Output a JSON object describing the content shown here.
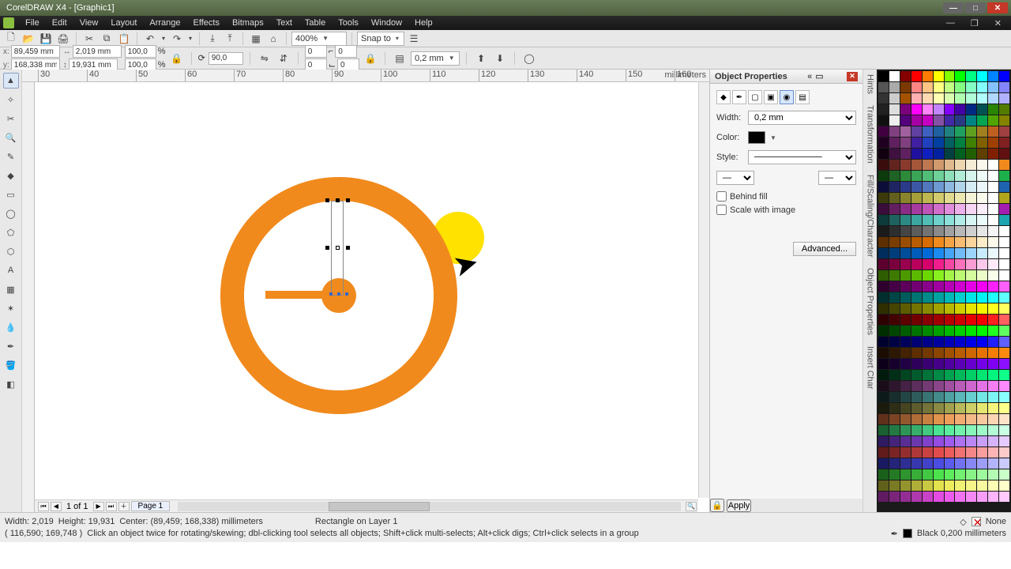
{
  "titlebar": {
    "title": "CorelDRAW X4 - [Graphic1]"
  },
  "menu": {
    "items": [
      "File",
      "Edit",
      "View",
      "Layout",
      "Arrange",
      "Effects",
      "Bitmaps",
      "Text",
      "Table",
      "Tools",
      "Window",
      "Help"
    ]
  },
  "toolbar1": {
    "zoom": "400%",
    "snap": "Snap to"
  },
  "propbar": {
    "x": "89,459 mm",
    "y": "168,338 mm",
    "w": "2,019 mm",
    "h": "19,931 mm",
    "sx": "100,0",
    "sy": "100,0",
    "rot": "90,0",
    "outline": "0,2 mm"
  },
  "ruler_unit": "millimeters",
  "hruler": {
    "start": 30,
    "end": 160,
    "step": 10
  },
  "vruler": {
    "values": [
      "",
      "",
      "",
      "",
      "",
      ""
    ]
  },
  "pages": {
    "label": "1 of 1",
    "tab": "Page 1"
  },
  "props": {
    "title": "Object Properties",
    "width_label": "Width:",
    "width_value": "0,2 mm",
    "color_label": "Color:",
    "style_label": "Style:",
    "behind": "Behind fill",
    "scale": "Scale with image",
    "advanced": "Advanced...",
    "apply": "Apply"
  },
  "sidetabs": [
    "Hints",
    "Transformation",
    "Fill/Scaling/Character",
    "Object Properties",
    "Insert Char"
  ],
  "status": {
    "line1_a": "Width: 2,019",
    "line1_b": "Height: 19,931",
    "line1_c": "Center: (89,459; 168,338)  millimeters",
    "line1_d": "Rectangle on Layer 1",
    "line2_a": "( 116,590; 169,748 )",
    "line2_b": "Click an object twice for rotating/skewing; dbl-clicking tool selects all objects; Shift+click multi-selects; Alt+click digs; Ctrl+click selects in a group",
    "fill_none": "None",
    "outline_info": "Black  0,200 millimeters"
  },
  "palette_colors": [
    "#000000",
    "#ffffff",
    "#840000",
    "#ff0000",
    "#ff7b00",
    "#ffff00",
    "#84ff00",
    "#00ff00",
    "#00ff84",
    "#00ffff",
    "#0084ff",
    "#0000ff",
    "#555555",
    "#aaaaaa",
    "#7b3900",
    "#ff8484",
    "#ffc384",
    "#ffff84",
    "#c3ff84",
    "#84ff84",
    "#84ffc3",
    "#84ffff",
    "#84c3ff",
    "#8484ff",
    "#333333",
    "#cccccc",
    "#a55200",
    "#ffb1b1",
    "#ffd9b1",
    "#ffffb1",
    "#d9ffb1",
    "#b1ffb1",
    "#b1ffd9",
    "#b1ffff",
    "#b1d9ff",
    "#b1b1ff",
    "#222222",
    "#dddddd",
    "#7b007b",
    "#ff00ff",
    "#ff84ff",
    "#c384ff",
    "#8400ff",
    "#4200a5",
    "#002984",
    "#005252",
    "#298400",
    "#527b00",
    "#111111",
    "#eeeeee",
    "#52007b",
    "#a500a5",
    "#c300c3",
    "#8452a5",
    "#4229a5",
    "#293984",
    "#008484",
    "#00a552",
    "#52a500",
    "#848400",
    "#400040",
    "#804080",
    "#a060a0",
    "#6040a0",
    "#4060c0",
    "#2060a0",
    "#208080",
    "#20a060",
    "#60a020",
    "#a08020",
    "#c06020",
    "#a04040",
    "#200020",
    "#602060",
    "#804080",
    "#4020a0",
    "#2040c0",
    "#0040a0",
    "#006060",
    "#008040",
    "#408000",
    "#806000",
    "#a04000",
    "#802020",
    "#100010",
    "#401040",
    "#602060",
    "#2010a0",
    "#1020c0",
    "#0020a0",
    "#004040",
    "#006020",
    "#206000",
    "#604000",
    "#802000",
    "#601010",
    "#3a0d0d",
    "#63241f",
    "#8a3a2c",
    "#a5573b",
    "#bd7752",
    "#d1996e",
    "#e0b98e",
    "#ecd6b1",
    "#f5ecd6",
    "#fbf7ec",
    "#ffffff",
    "#f08a1d",
    "#0d3a0d",
    "#1f6324",
    "#2c8a3a",
    "#3ba557",
    "#52bd77",
    "#6ed199",
    "#8ee0b9",
    "#b1ecd6",
    "#d6f5ec",
    "#ecfbf7",
    "#ffffff",
    "#1db04a",
    "#0d0d3a",
    "#1f2463",
    "#2c3a8a",
    "#3b57a5",
    "#5277bd",
    "#6e99d1",
    "#8eb9e0",
    "#b1d6ec",
    "#d6ecf5",
    "#ecf7fb",
    "#ffffff",
    "#1d63b0",
    "#3a3a0d",
    "#63601f",
    "#8a852c",
    "#a59f3b",
    "#bdb752",
    "#d1cb6e",
    "#e0db8e",
    "#ece8b1",
    "#f5f3d6",
    "#fbfaec",
    "#ffffff",
    "#b0a51d",
    "#3a0d3a",
    "#631f60",
    "#8a2c85",
    "#a53b9f",
    "#bd52b7",
    "#d16ecb",
    "#e08edb",
    "#ecb1e8",
    "#f5d6f3",
    "#fbecfa",
    "#ffffff",
    "#a51db0",
    "#0d3a3a",
    "#1f6360",
    "#2c8a85",
    "#3ba59f",
    "#52bdb7",
    "#6ed1cb",
    "#8ee0db",
    "#b1ece8",
    "#d6f5f3",
    "#ecfbfa",
    "#ffffff",
    "#1da5b0",
    "#1a1a1a",
    "#2e2e2e",
    "#454545",
    "#5c5c5c",
    "#737373",
    "#8a8a8a",
    "#a1a1a1",
    "#b8b8b8",
    "#cfcfcf",
    "#e6e6e6",
    "#f5f5f5",
    "#ffffff",
    "#5c2e00",
    "#7a3d00",
    "#994d00",
    "#b85c00",
    "#d66b00",
    "#f08a1d",
    "#f4a347",
    "#f7bb72",
    "#fad49d",
    "#fcecc8",
    "#fef8ea",
    "#ffffff",
    "#002e5c",
    "#003d7a",
    "#004d99",
    "#005cb8",
    "#006bd6",
    "#1d8af0",
    "#47a3f4",
    "#72bbf7",
    "#9dd4fa",
    "#c8ecfc",
    "#eaf8fe",
    "#ffffff",
    "#5c002e",
    "#7a003d",
    "#99004d",
    "#b8005c",
    "#d6006b",
    "#f01d8a",
    "#f447a3",
    "#f772bb",
    "#fa9dd4",
    "#fcc8ec",
    "#feeaf8",
    "#ffffff",
    "#2e5c00",
    "#3d7a00",
    "#4d9900",
    "#5cb800",
    "#6bd600",
    "#8af01d",
    "#a3f447",
    "#bbf772",
    "#d4fa9d",
    "#ecfcc8",
    "#f8feea",
    "#ffffff",
    "#2e002e",
    "#450045",
    "#5c005c",
    "#730073",
    "#8a008a",
    "#a100a1",
    "#b800b8",
    "#cf00cf",
    "#e600e6",
    "#f500f5",
    "#ff20ff",
    "#ff60ff",
    "#002e2e",
    "#004545",
    "#005c5c",
    "#007373",
    "#008a8a",
    "#00a1a1",
    "#00b8b8",
    "#00cfcf",
    "#00e6e6",
    "#00f5f5",
    "#20ffff",
    "#60ffff",
    "#2e2e00",
    "#454500",
    "#5c5c00",
    "#737300",
    "#8a8a00",
    "#a1a100",
    "#b8b800",
    "#cfcf00",
    "#e6e600",
    "#f5f500",
    "#ffff20",
    "#ffff60",
    "#2e0000",
    "#450000",
    "#5c0000",
    "#730000",
    "#8a0000",
    "#a10000",
    "#b80000",
    "#cf0000",
    "#e60000",
    "#f50000",
    "#ff2020",
    "#ff6060",
    "#002e00",
    "#004500",
    "#005c00",
    "#007300",
    "#008a00",
    "#00a100",
    "#00b800",
    "#00cf00",
    "#00e600",
    "#00f500",
    "#20ff20",
    "#60ff60",
    "#00002e",
    "#000045",
    "#00005c",
    "#000073",
    "#00008a",
    "#0000a1",
    "#0000b8",
    "#0000cf",
    "#0000e6",
    "#0000f5",
    "#2020ff",
    "#6060ff",
    "#1a0d00",
    "#2e1700",
    "#452200",
    "#5c2e00",
    "#733a00",
    "#8a4500",
    "#a15000",
    "#b85c00",
    "#cf6700",
    "#e67300",
    "#f57e00",
    "#ff8a10",
    "#0d001a",
    "#17002e",
    "#220045",
    "#2e005c",
    "#3a0073",
    "#45008a",
    "#5000a1",
    "#5c00b8",
    "#6700cf",
    "#7300e6",
    "#7e00f5",
    "#8a10ff",
    "#001a0d",
    "#002e17",
    "#004522",
    "#005c2e",
    "#00733a",
    "#008a45",
    "#00a150",
    "#00b85c",
    "#00cf67",
    "#00e673",
    "#00f57e",
    "#10ff8a",
    "#1a0d1a",
    "#2e172e",
    "#452245",
    "#5c2e5c",
    "#733a73",
    "#8a458a",
    "#a150a1",
    "#b85cb8",
    "#cf67cf",
    "#e673e6",
    "#f57ef5",
    "#ff8aff",
    "#0d1a1a",
    "#172e2e",
    "#224545",
    "#2e5c5c",
    "#3a7373",
    "#458a8a",
    "#50a1a1",
    "#5cb8b8",
    "#67cfcf",
    "#73e6e6",
    "#7ef5f5",
    "#8affff",
    "#1a1a0d",
    "#2e2e17",
    "#454522",
    "#5c5c2e",
    "#73733a",
    "#8a8a45",
    "#a1a150",
    "#b8b85c",
    "#cfcf67",
    "#e6e673",
    "#f5f57e",
    "#ffff8a",
    "#60301a",
    "#7a4424",
    "#94582e",
    "#ae6c38",
    "#c88042",
    "#e2944c",
    "#ec9f5c",
    "#f0ac72",
    "#f4ba88",
    "#f8c89e",
    "#fcd6b4",
    "#ffe4ca",
    "#1a6030",
    "#247a44",
    "#2e9458",
    "#38ae6c",
    "#42c880",
    "#4ce294",
    "#5cec9f",
    "#72f0ac",
    "#88f4ba",
    "#9ef8c8",
    "#b4fcd6",
    "#caffe4",
    "#301a60",
    "#44247a",
    "#582e94",
    "#6c38ae",
    "#8042c8",
    "#944ce2",
    "#9f5cec",
    "#ac72f0",
    "#ba88f4",
    "#c89ef8",
    "#d6b4fc",
    "#e4caff",
    "#601a1a",
    "#7a2424",
    "#942e2e",
    "#ae3838",
    "#c84242",
    "#e24c4c",
    "#ec5c5c",
    "#f07272",
    "#f48888",
    "#f89e9e",
    "#fcb4b4",
    "#ffcaca",
    "#1a1a60",
    "#24247a",
    "#2e2e94",
    "#3838ae",
    "#4242c8",
    "#4c4ce2",
    "#5c5cec",
    "#7272f0",
    "#8888f4",
    "#9e9ef8",
    "#b4b4fc",
    "#cacaff",
    "#1a601a",
    "#247a24",
    "#2e942e",
    "#38ae38",
    "#42c842",
    "#4ce24c",
    "#5cec5c",
    "#72f072",
    "#88f488",
    "#9ef89e",
    "#b4fcb4",
    "#caffca",
    "#60601a",
    "#7a7a24",
    "#94942e",
    "#aeae38",
    "#c8c842",
    "#e2e24c",
    "#ecec5c",
    "#f0f072",
    "#f4f488",
    "#f8f89e",
    "#fcfcb4",
    "#ffffca",
    "#601a60",
    "#7a247a",
    "#942e94",
    "#ae38ae",
    "#c842c8",
    "#e24ce2",
    "#ec5cec",
    "#f072f0",
    "#f488f4",
    "#f89ef8",
    "#fcb4fc",
    "#ffcaff"
  ]
}
